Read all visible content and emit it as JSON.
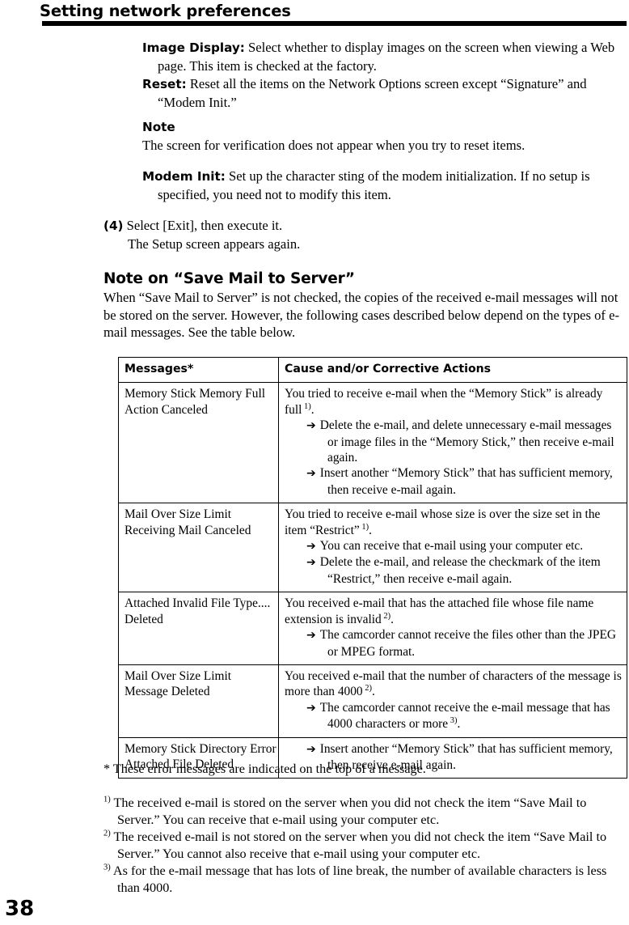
{
  "header": {
    "title": "Setting network preferences"
  },
  "definitions": [
    {
      "lead": "Image Display:",
      "text": " Select whether to display images on the screen when viewing a Web page. This item is checked at the factory."
    },
    {
      "lead": "Reset:",
      "text": " Reset all the items on the Network Options screen except “Signature” and “Modem Init.”"
    }
  ],
  "note": {
    "heading": "Note",
    "body": "The screen for verification does not appear when you try to reset items."
  },
  "modem_init": {
    "lead": "Modem Init:",
    "text": " Set up the character sting of the modem initialization. If no setup is specified, you need not to modify this item."
  },
  "step": {
    "number": "(4)",
    "text": " Select [Exit], then execute it.",
    "sub": "The Setup screen appears again."
  },
  "section": {
    "title": "Note on “Save Mail to Server”",
    "paragraph": "When “Save Mail to Server” is not checked, the copies of the received e-mail messages will not be stored on the server. However, the following cases described below depend on the types of e-mail messages. See the table below."
  },
  "table": {
    "headers": [
      "Messages*",
      "Cause and/or Corrective Actions"
    ],
    "rows": [
      {
        "message_lines": [
          "Memory Stick Memory Full",
          "Action Canceled"
        ],
        "cause_intro": "You tried to receive e-mail when the “Memory Stick” is already full",
        "cause_intro_sup": "1)",
        "cause_intro_tail": ".",
        "bullets": [
          "Delete the e-mail, and delete unnecessary e-mail messages or image files in the “Memory Stick,” then receive e-mail again.",
          "Insert another “Memory Stick” that has sufficient memory, then receive e-mail again."
        ]
      },
      {
        "message_lines": [
          "Mail Over Size Limit",
          "Receiving Mail Canceled"
        ],
        "cause_intro": "You tried to receive e-mail whose size is over the size set in the item “Restrict”",
        "cause_intro_sup": "1)",
        "cause_intro_tail": ".",
        "bullets": [
          "You can receive that e-mail using your computer etc.",
          "Delete the e-mail, and release the checkmark of the item “Restrict,” then receive e-mail again."
        ]
      },
      {
        "message_lines": [
          "Attached Invalid File Type....",
          "Deleted"
        ],
        "cause_intro": "You received e-mail that has the attached file whose file name extension is invalid",
        "cause_intro_sup": "2)",
        "cause_intro_tail": ".",
        "bullets": [
          "The camcorder cannot receive the files other than the JPEG or MPEG format."
        ]
      },
      {
        "message_lines": [
          "Mail Over Size Limit",
          "Message Deleted"
        ],
        "cause_intro": "You received e-mail that the number of characters of the message is more than 4000",
        "cause_intro_sup": "2)",
        "cause_intro_tail": ".",
        "bullets": [
          "The camcorder cannot receive the e-mail message that has 4000 characters or more",
          ""
        ],
        "bullet_sup": "3)",
        "bullet_tail": "."
      },
      {
        "message_lines": [
          "Memory Stick Directory Error",
          "Attached File Deleted"
        ],
        "cause_intro": "",
        "bullets": [
          "Insert another “Memory Stick” that has sufficient memory, then receive e-mail again."
        ]
      }
    ],
    "arrow_glyph": "➔"
  },
  "footnotes": {
    "star": "* These error messages are indicated on the top of a message.",
    "items": [
      {
        "mark": "1)",
        "text": " The received e-mail is stored on the server when you did not check the item “Save Mail to Server.” You can receive that e-mail using your computer etc."
      },
      {
        "mark": "2)",
        "text": " The received e-mail is not stored on the server when you did not check the item “Save Mail to Server.” You cannot also receive that e-mail using your computer etc."
      },
      {
        "mark": "3)",
        "text": " As for the e-mail message that has lots of line break, the number of available characters is less than 4000."
      }
    ]
  },
  "page_number": "38"
}
